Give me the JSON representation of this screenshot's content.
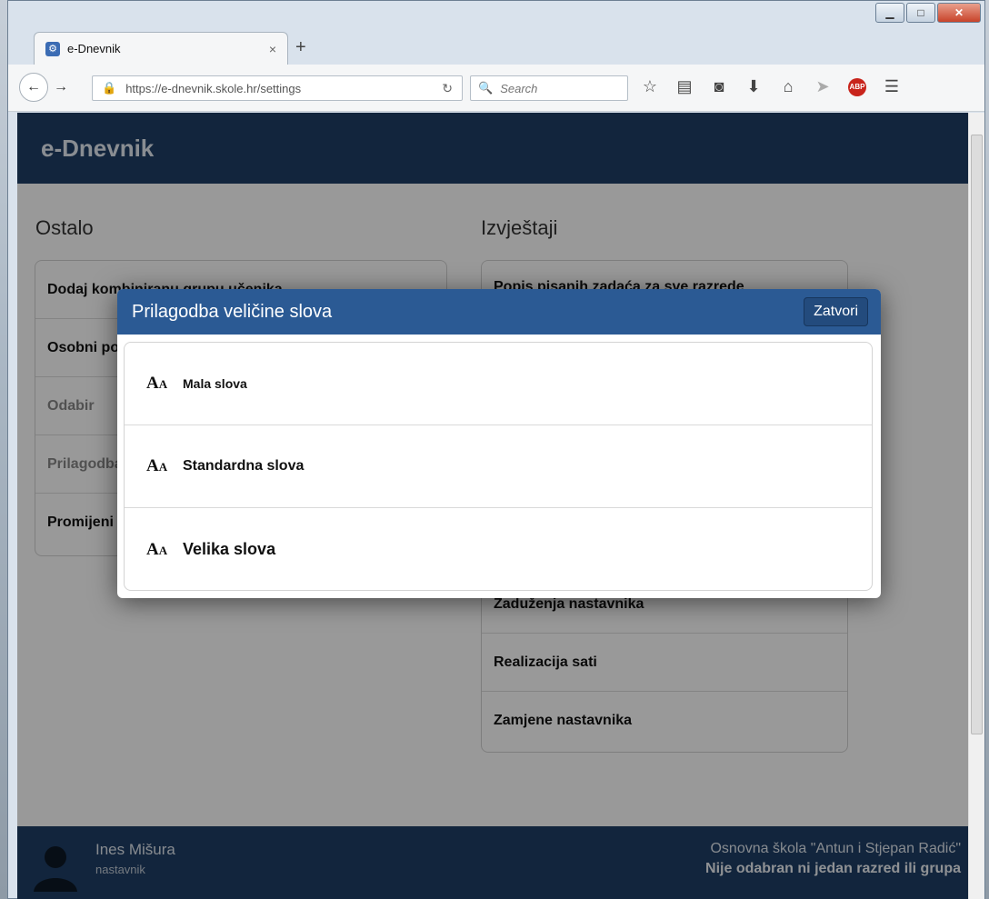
{
  "browser": {
    "tab_title": "e-Dnevnik",
    "tab_icon": "edna-icon",
    "url": "https://e-dnevnik.skole.hr/settings",
    "search_placeholder": "Search",
    "abp_label": "ABP",
    "win_controls": {
      "minimize": "▁",
      "maximize": "□",
      "close": "✕"
    }
  },
  "app": {
    "title": "e-Dnevnik",
    "header_color": "#1f3f66"
  },
  "left_section": {
    "title": "Ostalo",
    "items": [
      {
        "label": "Dodaj kombiniranu grupu učenika"
      },
      {
        "label": "Osobni podaci"
      },
      {
        "label": "Odabir"
      },
      {
        "label": "Prilagodba"
      },
      {
        "label": "Promijeni"
      }
    ]
  },
  "right_section": {
    "title": "Izvještaji",
    "items": [
      {
        "label": "Popis pisanih zadaća za sve razrede"
      },
      {
        "label": "Zaduženja nastavnika"
      },
      {
        "label": "Realizacija sati"
      },
      {
        "label": "Zamjene nastavnika"
      }
    ]
  },
  "modal": {
    "title": "Prilagodba veličine slova",
    "close_label": "Zatvori",
    "options": [
      {
        "label": "Mala slova",
        "icon": "font-size-icon",
        "size": 14
      },
      {
        "label": "Standardna slova",
        "icon": "font-size-icon",
        "size": 16
      },
      {
        "label": "Velika slova",
        "icon": "font-size-icon",
        "size": 18
      }
    ],
    "accent_color": "#2b5a94"
  },
  "footer": {
    "user_name": "Ines Mišura",
    "user_role": "nastavnik",
    "school": "Osnovna škola \"Antun i Stjepan Radić\"",
    "group_status": "Nije odabran ni jedan razred ili grupa"
  }
}
